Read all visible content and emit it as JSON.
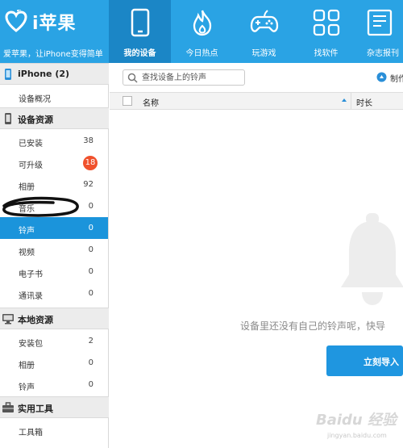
{
  "app": {
    "logo_text": "i苹果",
    "slogan": "爱苹果，让iPhone变得简单"
  },
  "nav": [
    {
      "label": "我的设备",
      "icon": "phone-icon",
      "active": true
    },
    {
      "label": "今日热点",
      "icon": "flame-icon"
    },
    {
      "label": "玩游戏",
      "icon": "gamepad-icon"
    },
    {
      "label": "找软件",
      "icon": "apps-grid-icon"
    },
    {
      "label": "杂志报刊",
      "icon": "magazine-icon"
    }
  ],
  "sidebar": {
    "device": {
      "title": "iPhone (2)",
      "icon": "iphone-icon"
    },
    "overview": "设备概况",
    "device_resources": {
      "title": "设备资源",
      "icon": "device-icon",
      "items": [
        {
          "label": "已安装",
          "count": "38"
        },
        {
          "label": "可升级",
          "count": "18"
        },
        {
          "label": "相册",
          "count": "92"
        },
        {
          "label": "音乐",
          "count": "0"
        },
        {
          "label": "铃声",
          "count": "0"
        },
        {
          "label": "视频",
          "count": "0"
        },
        {
          "label": "电子书",
          "count": "0"
        },
        {
          "label": "通讯录",
          "count": "0"
        }
      ]
    },
    "local_resources": {
      "title": "本地资源",
      "icon": "monitor-icon",
      "items": [
        {
          "label": "安装包",
          "count": "2"
        },
        {
          "label": "相册",
          "count": "0"
        },
        {
          "label": "铃声",
          "count": "0"
        }
      ]
    },
    "tools": {
      "title": "实用工具",
      "icon": "toolbox-icon",
      "items": [
        {
          "label": "工具箱"
        }
      ]
    }
  },
  "main": {
    "search_placeholder": "查找设备上的铃声",
    "make_label": "制作",
    "columns": {
      "name": "名称",
      "duration": "时长"
    },
    "empty_message": "设备里还没有自己的铃声呢，快导",
    "import_button": "立刻导入"
  },
  "watermark": {
    "logo": "Baidu 经验",
    "url": "jingyan.baidu.com"
  },
  "colors": {
    "header": "#2aa3e4",
    "nav_active": "#1b86c6",
    "selected_row": "#1b94db",
    "badge": "#f0512c",
    "import_button": "#1f96e0"
  }
}
